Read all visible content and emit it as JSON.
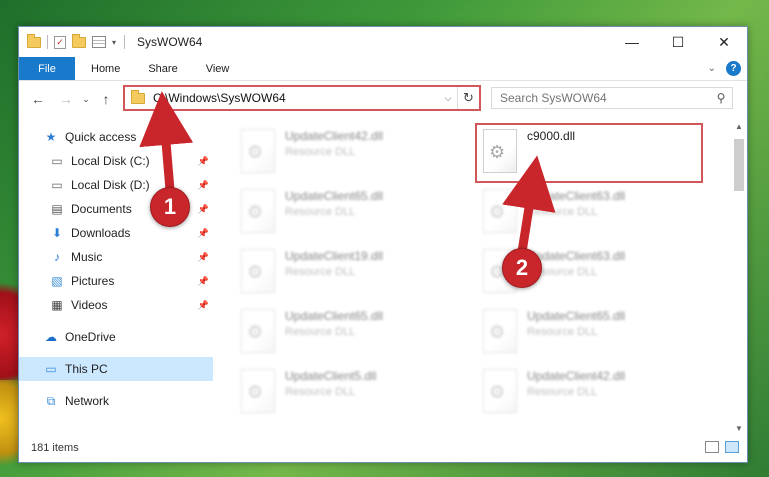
{
  "window": {
    "title": "SysWOW64",
    "controls": {
      "minimize": "—",
      "maximize": "☐",
      "close": "✕"
    }
  },
  "ribbon": {
    "tabs": [
      {
        "label": "File"
      },
      {
        "label": "Home"
      },
      {
        "label": "Share"
      },
      {
        "label": "View"
      }
    ],
    "expand_glyph": "⌄",
    "help_glyph": "?"
  },
  "address": {
    "path": "C:\\Windows\\SysWOW64",
    "refresh_glyph": "↻",
    "dropdown_glyph": "⌵"
  },
  "search": {
    "placeholder": "Search SysWOW64",
    "icon": "⚲"
  },
  "nav_buttons": {
    "back": "←",
    "forward": "→",
    "recent": "⌄",
    "up": "↑"
  },
  "sidebar": {
    "quick_access": "Quick access",
    "items": [
      {
        "label": "Local Disk (C:)",
        "icon": "drive-icon"
      },
      {
        "label": "Local Disk (D:)",
        "icon": "drive-icon"
      },
      {
        "label": "Documents",
        "icon": "documents-icon"
      },
      {
        "label": "Downloads",
        "icon": "downloads-icon"
      },
      {
        "label": "Music",
        "icon": "music-icon"
      },
      {
        "label": "Pictures",
        "icon": "pictures-icon"
      },
      {
        "label": "Videos",
        "icon": "videos-icon"
      }
    ],
    "onedrive": "OneDrive",
    "this_pc": "This PC",
    "network": "Network"
  },
  "files": [
    {
      "name": "UpdateClient42.dll",
      "type": "Resource DLL"
    },
    {
      "name": "c9000.dll",
      "type": ""
    },
    {
      "name": "UpdateClient65.dll",
      "type": "Resource DLL"
    },
    {
      "name": "UpdateClient63.dll",
      "type": "Resource DLL"
    },
    {
      "name": "UpdateClient19.dll",
      "type": "Resource DLL"
    },
    {
      "name": "UpdateClient63.dll",
      "type": "Resource DLL"
    },
    {
      "name": "UpdateClient65.dll",
      "type": "Resource DLL"
    },
    {
      "name": "UpdateClient65.dll",
      "type": "Resource DLL"
    },
    {
      "name": "UpdateClient5.dll",
      "type": "Resource DLL"
    },
    {
      "name": "UpdateClient42.dll",
      "type": "Resource DLL"
    }
  ],
  "status": {
    "item_count": "181 items"
  },
  "markers": {
    "one": "1",
    "two": "2"
  },
  "colors": {
    "accent": "#1979ca",
    "annotation_red": "#d0575a",
    "marker_red": "#c8262b",
    "selection": "#cce8ff"
  }
}
